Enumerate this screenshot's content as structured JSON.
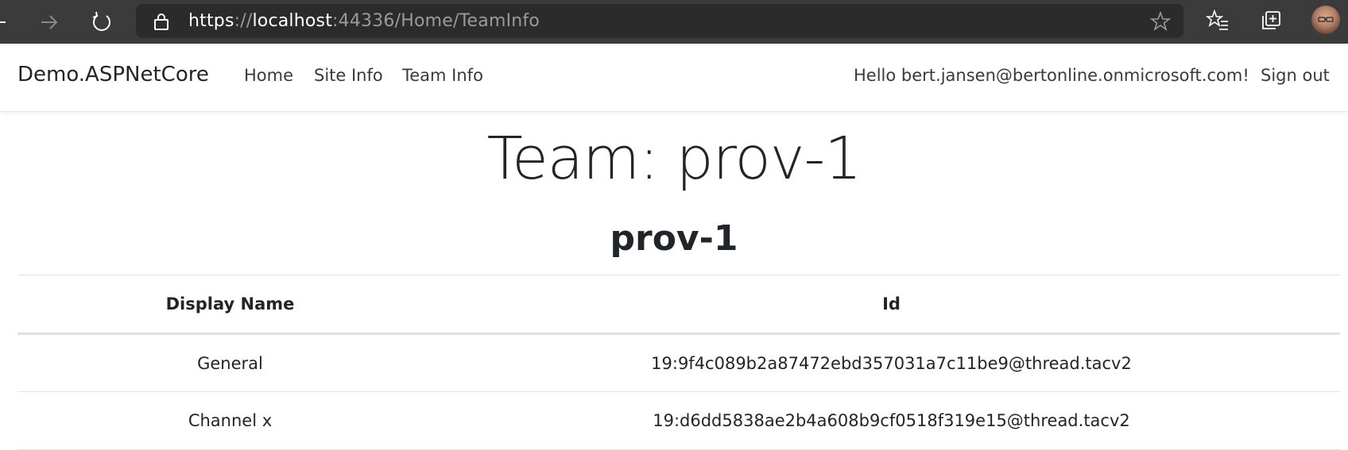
{
  "browser": {
    "url_scheme": "https",
    "url_sep": "://",
    "url_host": "localhost",
    "url_rest": ":44336/Home/TeamInfo",
    "colors": {
      "chrome": "#3b3b3b",
      "address_bar": "#2b2b2b"
    }
  },
  "navbar": {
    "brand": "Demo.ASPNetCore",
    "links": [
      "Home",
      "Site Info",
      "Team Info"
    ],
    "greeting": "Hello bert.jansen@bertonline.onmicrosoft.com!",
    "signout": "Sign out"
  },
  "main": {
    "title": "Team: prov-1",
    "subtitle": "prov-1",
    "table": {
      "headers": [
        "Display Name",
        "Id"
      ],
      "rows": [
        [
          "General",
          "19:9f4c089b2a87472ebd357031a7c11be9@thread.tacv2"
        ],
        [
          "Channel x",
          "19:d6dd5838ae2b4a608b9cf0518f319e15@thread.tacv2"
        ]
      ]
    }
  }
}
